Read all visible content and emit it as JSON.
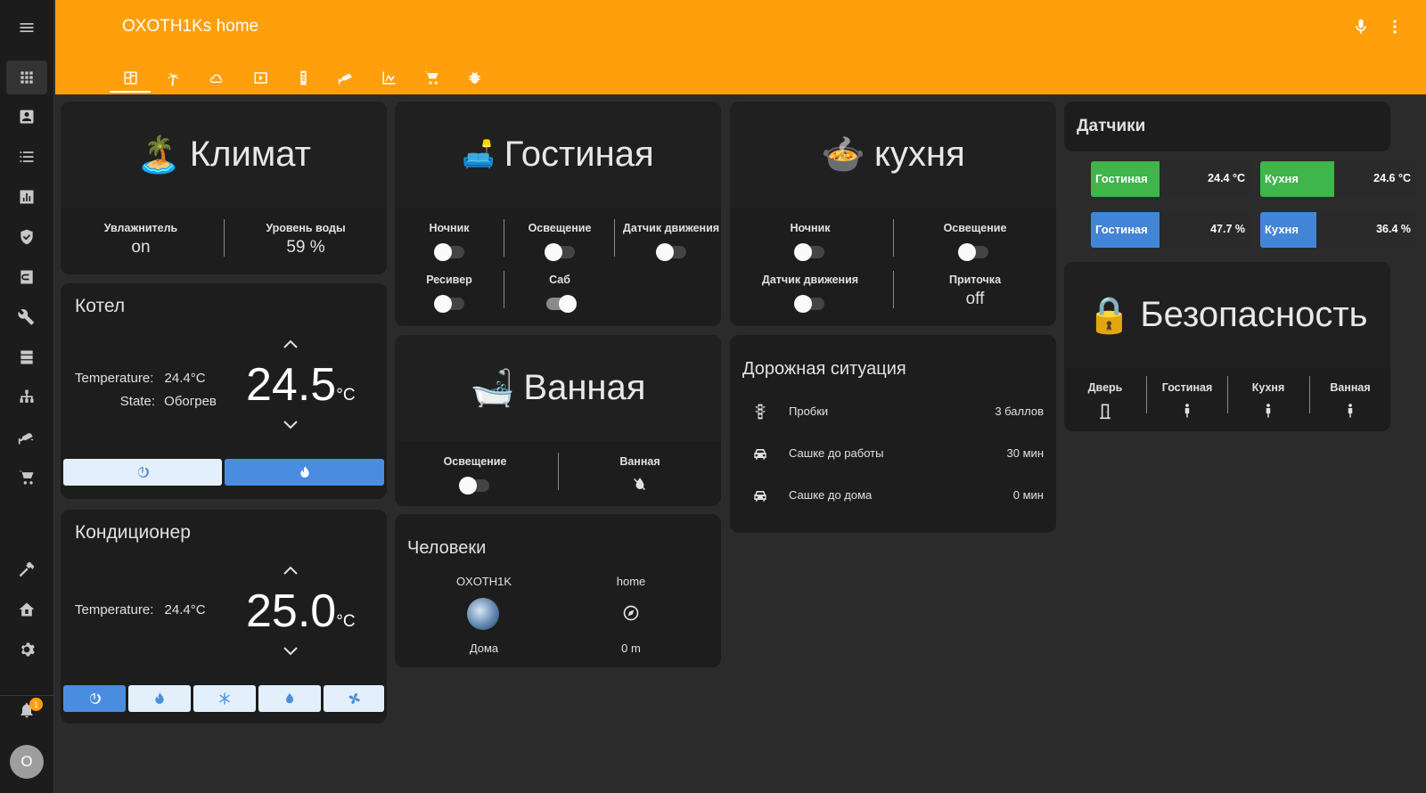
{
  "app": {
    "title": "OXOTH1Ks home"
  },
  "sidebar": {
    "items": [
      "apps-icon",
      "account-box-icon",
      "list-icon",
      "chart-icon",
      "shield-icon",
      "calendar-icon",
      "wrench-icon",
      "server-icon",
      "network-icon",
      "cctv-icon",
      "cart-icon",
      "hammer-icon",
      "home-automation-icon",
      "settings-icon"
    ],
    "notifications_badge": "1",
    "avatar_initial": "O"
  },
  "tabs": [
    "dashboard-icon",
    "palm-tree-icon",
    "weather-icon",
    "media-icon",
    "remote-icon",
    "cctv-icon",
    "chart-line-icon",
    "cart-icon",
    "bug-icon"
  ],
  "climate": {
    "title": "Климат",
    "icon": "🏝️",
    "humidifier_label": "Увлажнитель",
    "humidifier_value": "on",
    "water_label": "Уровень воды",
    "water_value": "59 %"
  },
  "boiler": {
    "title": "Котел",
    "temp_label": "Temperature:",
    "temp_value": "24.4°C",
    "state_label": "State:",
    "state_value": "Обогрев",
    "target": "24.5",
    "unit": "°C"
  },
  "ac": {
    "title": "Кондиционер",
    "temp_label": "Temperature:",
    "temp_value": "24.4°C",
    "target": "25.0",
    "unit": "°C"
  },
  "living": {
    "title": "Гостиная",
    "icon": "🛋️",
    "nightlight": "Ночник",
    "light": "Освещение",
    "motion": "Датчик движения",
    "receiver": "Ресивер",
    "sub": "Саб"
  },
  "bath": {
    "title": "Ванная",
    "icon": "🛁",
    "light": "Освещение",
    "bath": "Ванная"
  },
  "people": {
    "title": "Человеки",
    "p1_name": "OXOTH1K",
    "p1_state": "Дома",
    "p2_name": "home",
    "p2_state": "0 m"
  },
  "kitchen": {
    "title": "кухня",
    "icon": "🍲",
    "nightlight": "Ночник",
    "light": "Освещение",
    "motion": "Датчик движения",
    "vent": "Приточка",
    "vent_value": "off"
  },
  "road": {
    "title": "Дорожная ситуация",
    "rows": [
      {
        "name": "Пробки",
        "value": "3 баллов"
      },
      {
        "name": "Сашке до работы",
        "value": "30 мин"
      },
      {
        "name": "Сашке до дома",
        "value": "0 мин"
      }
    ]
  },
  "sensors": {
    "title": "Датчики",
    "items": [
      {
        "label": "Гостиная",
        "value": "24.4 °C",
        "color": "#3fb54a",
        "level": 0.43
      },
      {
        "label": "Кухня",
        "value": "24.6 °C",
        "color": "#3fb54a",
        "level": 0.47
      },
      {
        "label": "Гостиная",
        "value": "47.7 %",
        "color": "#4285d6",
        "level": 0.43
      },
      {
        "label": "Кухня",
        "value": "36.4 %",
        "color": "#4285d6",
        "level": 0.36
      }
    ]
  },
  "security": {
    "title": "Безопасность",
    "icon": "🔒",
    "door": "Дверь",
    "living": "Гостиная",
    "kitchen": "Кухня",
    "bath": "Ванная"
  }
}
